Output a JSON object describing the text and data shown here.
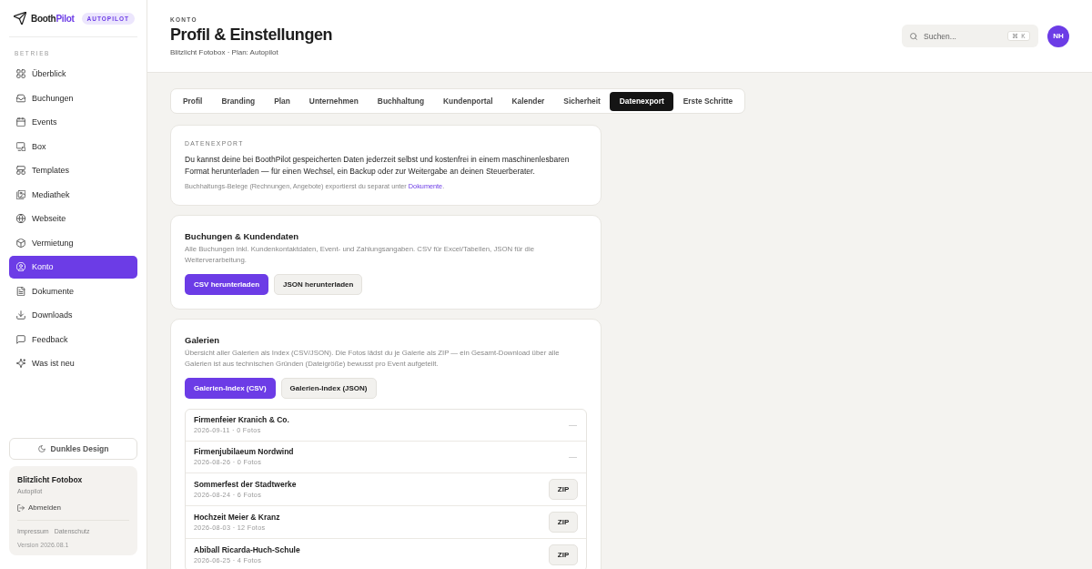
{
  "sidebar": {
    "logo": {
      "text": "Booth",
      "accent": "Pilot"
    },
    "badge": "AUTOPILOT",
    "section_label": "BETRIEB",
    "items": [
      {
        "label": "Überblick",
        "selected": false
      },
      {
        "label": "Buchungen",
        "selected": false
      },
      {
        "label": "Events",
        "selected": false
      },
      {
        "label": "Box",
        "selected": false
      },
      {
        "label": "Templates",
        "selected": false
      },
      {
        "label": "Mediathek",
        "selected": false
      },
      {
        "label": "Webseite",
        "selected": false
      },
      {
        "label": "Vermietung",
        "selected": false
      },
      {
        "label": "Konto",
        "selected": true
      },
      {
        "label": "Dokumente",
        "selected": false
      },
      {
        "label": "Downloads",
        "selected": false
      },
      {
        "label": "Feedback",
        "selected": false
      },
      {
        "label": "Was ist neu",
        "selected": false
      }
    ],
    "theme_button": "Dunkles Design",
    "account": {
      "name": "Blitzlicht Fotobox",
      "plan": "Autopilot",
      "logout": "Abmelden",
      "links": [
        "Impressum",
        "Datenschutz"
      ],
      "version": "Version 2026.08.1"
    }
  },
  "header": {
    "eyebrow": "KONTO",
    "title": "Profil & Einstellungen",
    "subtitle": "Blitzlicht Fotobox · Plan: Autopilot",
    "search": {
      "placeholder": "Suchen...",
      "shortcut": "⌘ K"
    },
    "avatar": "NH"
  },
  "tabs": [
    {
      "label": "Profil",
      "selected": false
    },
    {
      "label": "Branding",
      "selected": false
    },
    {
      "label": "Plan",
      "selected": false
    },
    {
      "label": "Unternehmen",
      "selected": false
    },
    {
      "label": "Buchhaltung",
      "selected": false
    },
    {
      "label": "Kundenportal",
      "selected": false
    },
    {
      "label": "Kalender",
      "selected": false
    },
    {
      "label": "Sicherheit",
      "selected": false
    },
    {
      "label": "Datenexport",
      "selected": true
    },
    {
      "label": "Erste Schritte",
      "selected": false
    }
  ],
  "intro": {
    "label": "DATENEXPORT",
    "text": "Du kannst deine bei BoothPilot gespeicherten Daten jederzeit selbst und kostenfrei in einem maschinenlesbaren Format herunterladen — für einen Wechsel, ein Backup oder zur Weitergabe an deinen Steuerberater.",
    "note": "Buchhaltungs-Belege (Rechnungen, Angebote) exportierst du separat unter",
    "link": "Dokumente",
    "note_end": "."
  },
  "sections": [
    {
      "title": "Buchungen & Kundendaten",
      "description": "Alle Buchungen inkl. Kundenkontaktdaten, Event- und Zahlungsangaben. CSV für Excel/Tabellen, JSON für die Weiterverarbeitung.",
      "buttons": [
        {
          "label": "CSV herunterladen",
          "kind": "primary"
        },
        {
          "label": "JSON herunterladen",
          "kind": "secondary"
        }
      ]
    },
    {
      "title": "Galerien",
      "description": "Übersicht aller Galerien als Index (CSV/JSON). Die Fotos lädst du je Galerie als ZIP — ein Gesamt-Download über alle Galerien ist aus technischen Gründen (Dateigröße) bewusst pro Event aufgeteilt.",
      "buttons": [
        {
          "label": "Galerien-Index (CSV)",
          "kind": "primary"
        },
        {
          "label": "Galerien-Index (JSON)",
          "kind": "secondary"
        }
      ],
      "galleries": [
        {
          "name": "Firmenfeier Kranich & Co.",
          "meta": "2026-09-11 · 0 Fotos",
          "action": {
            "kind": "none",
            "label": "—"
          }
        },
        {
          "name": "Firmenjubilaeum Nordwind",
          "meta": "2026-08-26 · 0 Fotos",
          "action": {
            "kind": "none",
            "label": "—"
          }
        },
        {
          "name": "Sommerfest der Stadtwerke",
          "meta": "2026-08-24 · 6 Fotos",
          "action": {
            "kind": "zip",
            "label": "ZIP"
          }
        },
        {
          "name": "Hochzeit Meier & Kranz",
          "meta": "2026-08-03 · 12 Fotos",
          "action": {
            "kind": "zip",
            "label": "ZIP"
          }
        },
        {
          "name": "Abiball Ricarda-Huch-Schule",
          "meta": "2026-06-25 · 4 Fotos",
          "action": {
            "kind": "zip",
            "label": "ZIP"
          }
        }
      ]
    }
  ]
}
